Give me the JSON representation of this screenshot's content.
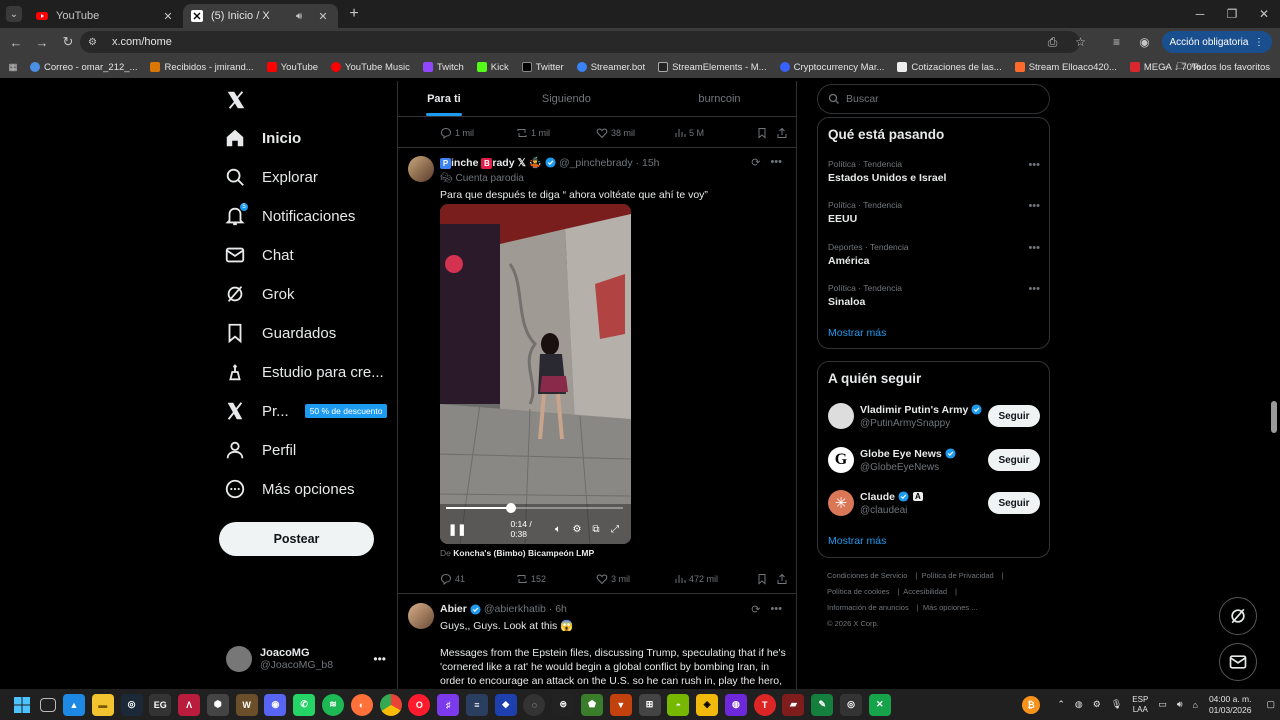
{
  "browser": {
    "tabs": [
      {
        "title": "YouTube",
        "active": false
      },
      {
        "title": "(5) Inicio / X",
        "active": true
      }
    ],
    "url": "x.com/home",
    "action_button": "Acción obligatoria",
    "bookmarks": [
      "Correo - omar_212_...",
      "Recibidos - jmirand...",
      "YouTube",
      "YouTube Music",
      "Twitch",
      "Kick",
      "Twitter",
      "Streamer.bot",
      "StreamElements - M...",
      "Cryptocurrency Mar...",
      "Cotizaciones de las...",
      "Stream Elloaco420...",
      "MEGA ↓ 70%"
    ],
    "all_bookmarks": "Todos los favoritos"
  },
  "nav": {
    "items": [
      {
        "label": "Inicio",
        "icon": "home-icon"
      },
      {
        "label": "Explorar",
        "icon": "search-icon"
      },
      {
        "label": "Notificaciones",
        "icon": "bell-icon"
      },
      {
        "label": "Chat",
        "icon": "mail-icon"
      },
      {
        "label": "Grok",
        "icon": "grok-icon"
      },
      {
        "label": "Guardados",
        "icon": "bookmark-icon"
      },
      {
        "label": "Estudio para cre...",
        "icon": "studio-icon"
      },
      {
        "label": "Pr...",
        "icon": "x-premium-icon"
      },
      {
        "label": "Perfil",
        "icon": "person-icon"
      },
      {
        "label": "Más opciones",
        "icon": "more-circle-icon"
      }
    ],
    "promo": "50 % de descuento",
    "post_button": "Postear",
    "account": {
      "name": "JoacoMG",
      "handle": "@JoacoMG_b8"
    }
  },
  "feed": {
    "tabs": [
      "Para ti",
      "Siguiendo",
      "burncoin"
    ],
    "prev_actions": {
      "replies": "1 mil",
      "reposts": "1 mil",
      "likes": "38 mil",
      "views": "5 M"
    },
    "tweet1": {
      "name_rest": "inche",
      "name_rest2": "rady",
      "name_suffix": "𝕏",
      "handle_time": "@_pinchebrady · 15h",
      "label": "Cuenta parodia",
      "text": "Para que después te diga “ ahora voltéate que ahí te voy”",
      "video_time": "0:14 / 0:38",
      "video_progress": 0.37,
      "source_prefix": "De",
      "source_name": "Koncha's (Bimbo) Bicampeón LMP",
      "replies": "41",
      "reposts": "152",
      "likes": "3 mil",
      "views": "472 mil"
    },
    "tweet2": {
      "name": "Abier",
      "handle_time": "@abierkhatib · 6h",
      "text1": "Guys,, Guys. Look at this 😱",
      "text2": "Messages from the Epstein files, discussing Trump, speculating that if he's 'cornered like a rat' he would begin a global conflict by bombing Iran, in order to encourage an attack on the U.S. so he can rush in, play the hero,"
    }
  },
  "sidebar": {
    "search_placeholder": "Buscar",
    "trending_title": "Qué está pasando",
    "trends": [
      {
        "category": "Política · Tendencia",
        "name": "Estados Unidos e Israel"
      },
      {
        "category": "Política · Tendencia",
        "name": "EEUU"
      },
      {
        "category": "Deportes · Tendencia",
        "name": "América"
      },
      {
        "category": "Política · Tendencia",
        "name": "Sinaloa"
      }
    ],
    "show_more": "Mostrar más",
    "who_to_follow_title": "A quién seguir",
    "follow": [
      {
        "name": "Vladimir Putin's Army",
        "handle": "@PutinArmySnappy"
      },
      {
        "name": "Globe Eye News",
        "handle": "@GlobeEyeNews"
      },
      {
        "name": "Claude",
        "handle": "@claudeai"
      }
    ],
    "follow_button": "Seguir",
    "footer": [
      "Condiciones de Servicio",
      "Política de Privacidad",
      "Política de cookies",
      "Accesibilidad",
      "Información de anuncios",
      "Más opciones ...",
      "© 2026 X Corp."
    ]
  },
  "taskbar": {
    "lang1": "ESP",
    "lang2": "LAA",
    "time": "04:00 a. m.",
    "date": "01/03/2026"
  },
  "colors": {
    "accent": "#1d9bf0",
    "background": "#000000",
    "muted": "#71767b"
  }
}
